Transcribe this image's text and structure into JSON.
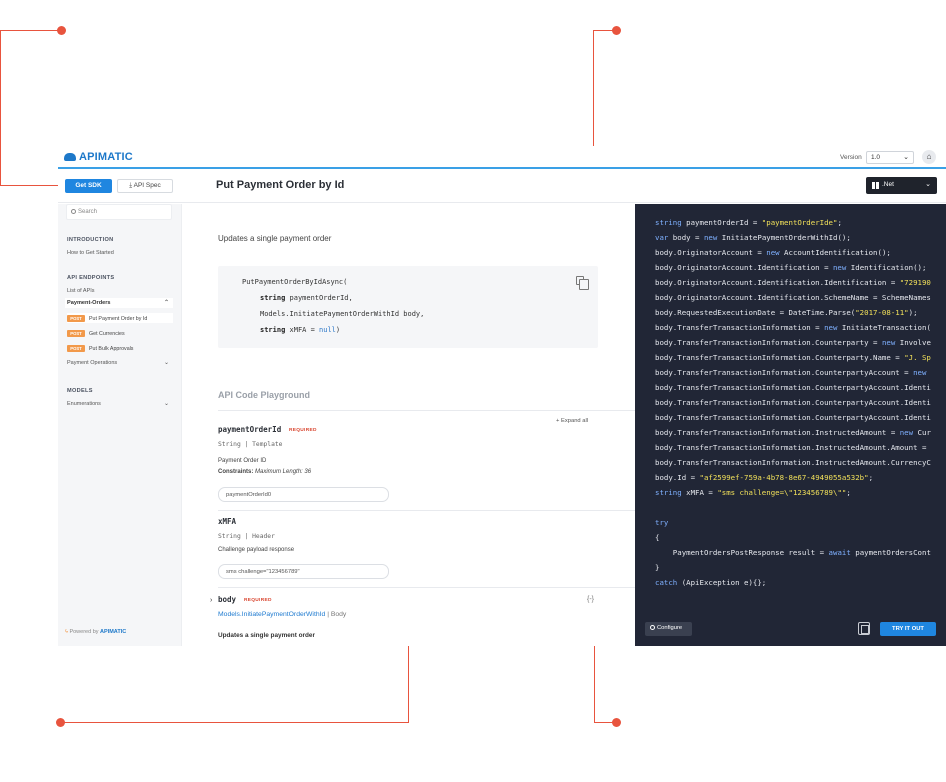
{
  "brand": {
    "name": "APIMATIC"
  },
  "header": {
    "version_label": "Version",
    "version_value": "1.0",
    "home_icon": "home-icon"
  },
  "toolbar": {
    "get_sdk": "Get SDK",
    "api_spec": "API Spec",
    "page_title": "Put Payment Order by Id",
    "language": ".Net"
  },
  "sidebar": {
    "search_placeholder": "Search",
    "introduction": "INTRODUCTION",
    "how_to": "How to Get Started",
    "api_endpoints": "API ENDPOINTS",
    "list_of_apis": "List of APIs",
    "payment_orders": "Payment-Orders",
    "endpoints": [
      {
        "method": "POST",
        "label": "Put Payment Order by Id"
      },
      {
        "method": "POST",
        "label": "Get Currencies"
      },
      {
        "method": "POST",
        "label": "Put Bulk Approvals"
      }
    ],
    "payment_operations": "Payment Operations",
    "models": "MODELS",
    "enumerations": "Enumerations",
    "powered_prefix": "Powered by",
    "powered_brand": "APIMATIC"
  },
  "main": {
    "summary": "Updates a single payment order",
    "signature": {
      "method": "PutPaymentOrderByIdAsync(",
      "p1_type": "string",
      "p1_name": " paymentOrderId,",
      "p2": "Models.InitiatePaymentOrderWithId body,",
      "p3_type": "string",
      "p3_name": " xMFA = ",
      "p3_value": "null",
      "close": ")"
    },
    "playground_title": "API Code Playground",
    "expand_all": "+ Expand all",
    "params": [
      {
        "name": "paymentOrderId",
        "required": "REQUIRED",
        "type": "String | Template",
        "desc": "Payment Order ID",
        "constraints_label": "Constraints:",
        "constraints_value": "Maximum Length: 36",
        "value": "paymentOrderId0"
      },
      {
        "name": "xMFA",
        "type": "String | Header",
        "desc": "Challenge payload response",
        "value": "sms challenge=\"123456789\""
      }
    ],
    "body": {
      "name": "body",
      "required": "REQUIRED",
      "type_link": "Models.InitiatePaymentOrderWithId",
      "type_suffix": "| Body",
      "desc": "Updates a single payment order",
      "toggle": "{-}"
    }
  },
  "code": {
    "lines": [
      [
        {
          "t": "string",
          "c": "kw"
        },
        {
          "t": " paymentOrderId = "
        },
        {
          "t": "\"paymentOrderIde\"",
          "c": "str"
        },
        {
          "t": ";"
        }
      ],
      [
        {
          "t": "var",
          "c": "kw"
        },
        {
          "t": " body = "
        },
        {
          "t": "new",
          "c": "kw"
        },
        {
          "t": " InitiatePaymentOrderWithId();"
        }
      ],
      [
        {
          "t": "body.OriginatorAccount = "
        },
        {
          "t": "new",
          "c": "kw"
        },
        {
          "t": " AccountIdentification();"
        }
      ],
      [
        {
          "t": "body.OriginatorAccount.Identification = "
        },
        {
          "t": "new",
          "c": "kw"
        },
        {
          "t": " Identification();"
        }
      ],
      [
        {
          "t": "body.OriginatorAccount.Identification.Identification = "
        },
        {
          "t": "\"729190",
          "c": "str"
        }
      ],
      [
        {
          "t": "body.OriginatorAccount.Identification.SchemeName = SchemeNames"
        }
      ],
      [
        {
          "t": "body.RequestedExecutionDate = DateTime.Parse("
        },
        {
          "t": "\"2017-08-11\"",
          "c": "str"
        },
        {
          "t": ");"
        }
      ],
      [
        {
          "t": "body.TransferTransactionInformation = "
        },
        {
          "t": "new",
          "c": "kw"
        },
        {
          "t": " InitiateTransaction("
        }
      ],
      [
        {
          "t": "body.TransferTransactionInformation.Counterparty = "
        },
        {
          "t": "new",
          "c": "kw"
        },
        {
          "t": " Involve"
        }
      ],
      [
        {
          "t": "body.TransferTransactionInformation.Counterparty.Name = "
        },
        {
          "t": "\"J. Sp",
          "c": "str"
        }
      ],
      [
        {
          "t": "body.TransferTransactionInformation.CounterpartyAccount = "
        },
        {
          "t": "new",
          "c": "kw"
        }
      ],
      [
        {
          "t": "body.TransferTransactionInformation.CounterpartyAccount.Identi"
        }
      ],
      [
        {
          "t": "body.TransferTransactionInformation.CounterpartyAccount.Identi"
        }
      ],
      [
        {
          "t": "body.TransferTransactionInformation.CounterpartyAccount.Identi"
        }
      ],
      [
        {
          "t": "body.TransferTransactionInformation.InstructedAmount = "
        },
        {
          "t": "new",
          "c": "kw"
        },
        {
          "t": " Cur"
        }
      ],
      [
        {
          "t": "body.TransferTransactionInformation.InstructedAmount.Amount = "
        }
      ],
      [
        {
          "t": "body.TransferTransactionInformation.InstructedAmount.CurrencyC"
        }
      ],
      [
        {
          "t": "body.Id = "
        },
        {
          "t": "\"af2599ef-759a-4b78-8e67-4949055a532b\"",
          "c": "str"
        },
        {
          "t": ";"
        }
      ],
      [
        {
          "t": "string",
          "c": "kw"
        },
        {
          "t": " xMFA = "
        },
        {
          "t": "\"sms challenge=\\\"123456789\\\"\"",
          "c": "str"
        },
        {
          "t": ";"
        }
      ],
      [],
      [
        {
          "t": "try",
          "c": "kw"
        }
      ],
      [
        {
          "t": "{"
        }
      ],
      [
        {
          "t": "    PaymentOrdersPostResponse result = "
        },
        {
          "t": "await",
          "c": "kw"
        },
        {
          "t": " paymentOrdersCont"
        }
      ],
      [
        {
          "t": "}"
        }
      ],
      [
        {
          "t": "catch",
          "c": "kw"
        },
        {
          "t": " (ApiException e){};"
        }
      ]
    ],
    "configure": "Configure",
    "try_it_out": "TRY IT OUT"
  },
  "colors": {
    "accent": "#1f86e0",
    "callout": "#e8543e",
    "code_bg": "#212636",
    "post_badge": "#f2994a"
  }
}
